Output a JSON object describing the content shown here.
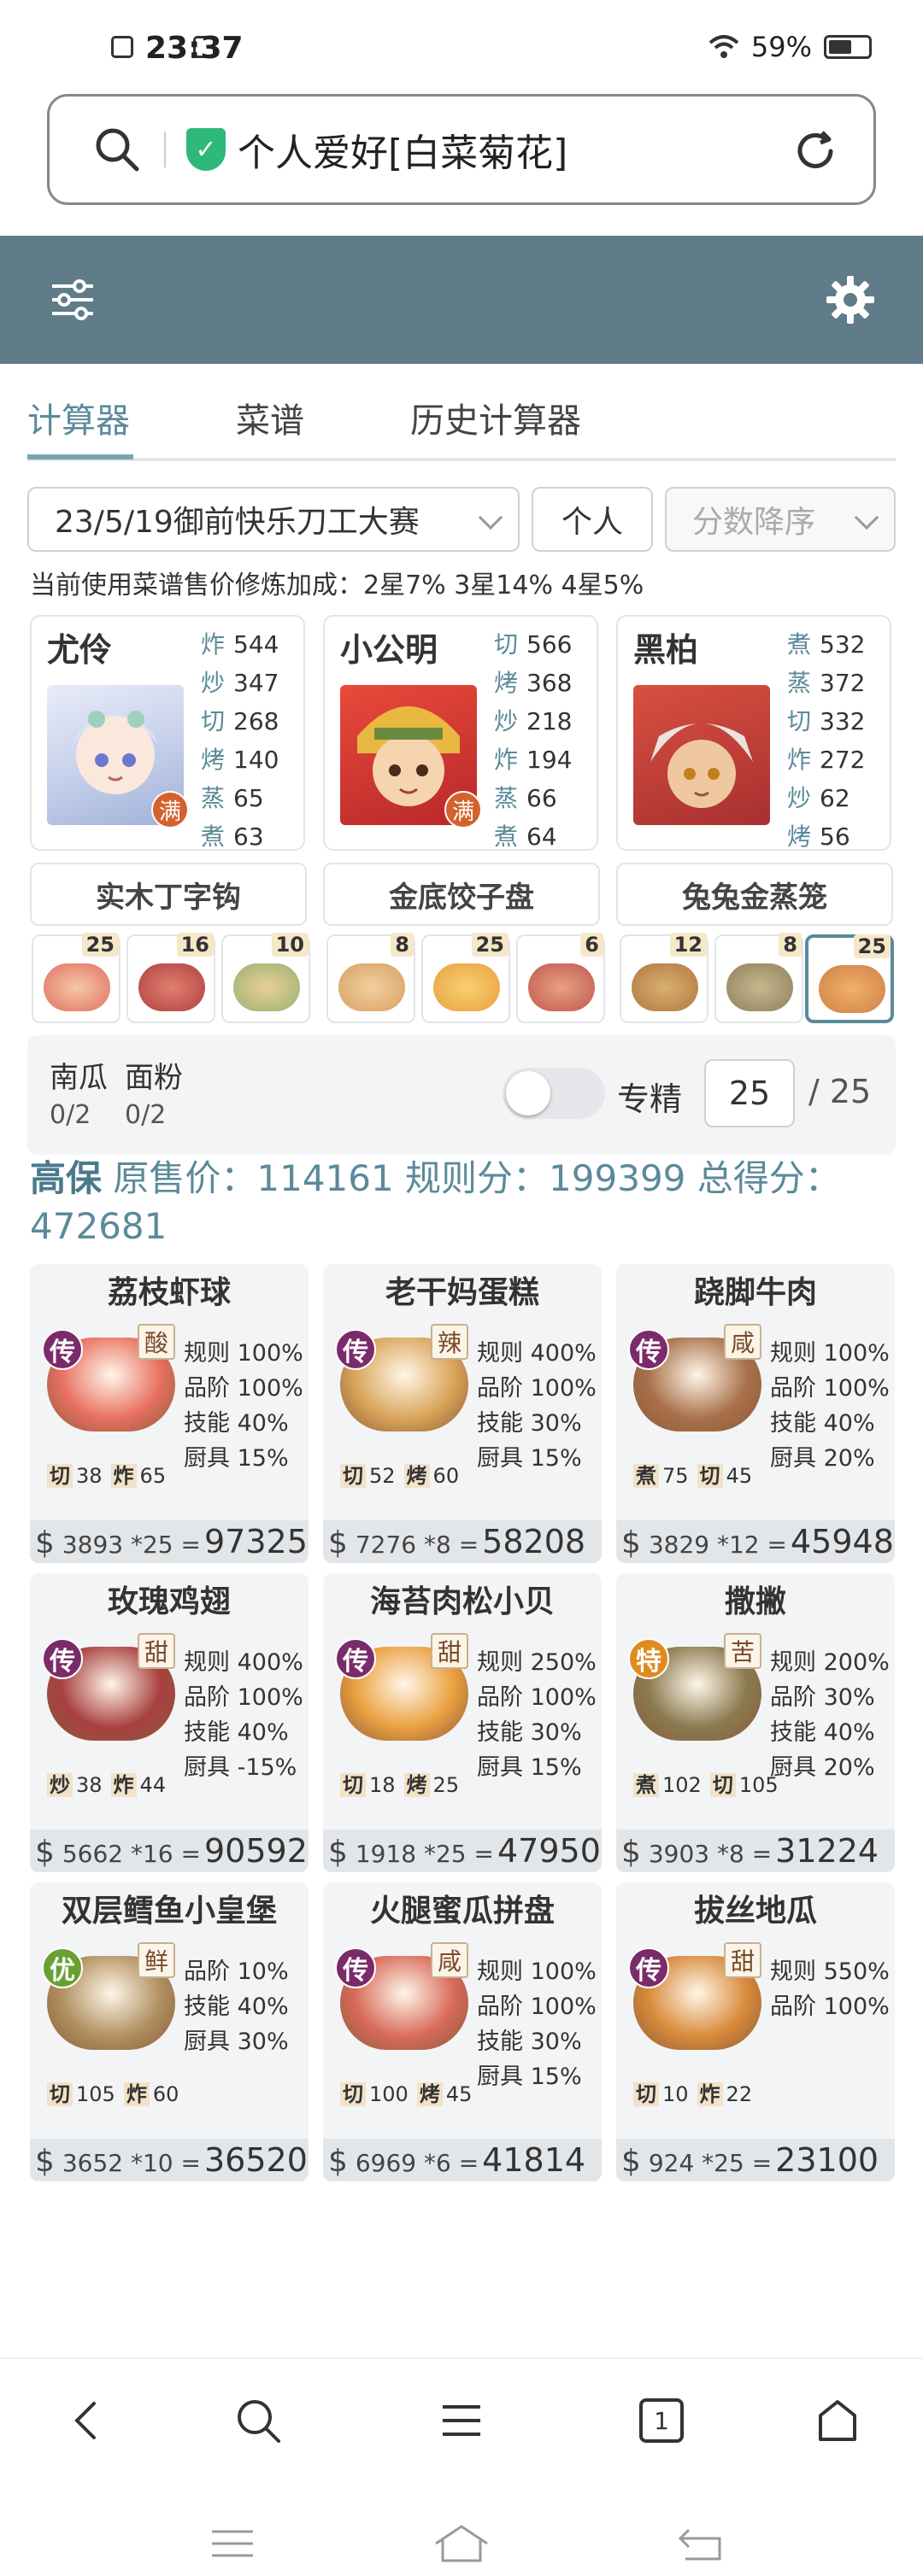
{
  "status": {
    "time": "23:37",
    "battery": "59%"
  },
  "address": {
    "url": "个人爱好[白菜菊花]",
    "secure_mark": "✓"
  },
  "tabs": [
    {
      "label": "计算器"
    },
    {
      "label": "菜谱"
    },
    {
      "label": "历史计算器"
    }
  ],
  "filters": {
    "contest": "23/5/19御前快乐刀工大赛",
    "mode": "个人",
    "sort": "分数降序"
  },
  "bonus_info": "当前使用菜谱售价修炼加成：2星7% 3星14% 4星5%",
  "chefs": [
    {
      "name": "尤伶",
      "badge": "满",
      "stats": [
        {
          "k": "炸",
          "v": "544"
        },
        {
          "k": "炒",
          "v": "347"
        },
        {
          "k": "切",
          "v": "268"
        },
        {
          "k": "烤",
          "v": "140"
        },
        {
          "k": "蒸",
          "v": "65"
        },
        {
          "k": "煮",
          "v": "63"
        }
      ]
    },
    {
      "name": "小公明",
      "badge": "满",
      "stats": [
        {
          "k": "切",
          "v": "566"
        },
        {
          "k": "烤",
          "v": "368"
        },
        {
          "k": "炒",
          "v": "218"
        },
        {
          "k": "炸",
          "v": "194"
        },
        {
          "k": "蒸",
          "v": "66"
        },
        {
          "k": "煮",
          "v": "64"
        }
      ]
    },
    {
      "name": "黑柏",
      "badge": "",
      "stats": [
        {
          "k": "煮",
          "v": "532"
        },
        {
          "k": "蒸",
          "v": "372"
        },
        {
          "k": "切",
          "v": "332"
        },
        {
          "k": "炸",
          "v": "272"
        },
        {
          "k": "炒",
          "v": "62"
        },
        {
          "k": "烤",
          "v": "56"
        }
      ]
    }
  ],
  "equipment": [
    "实木丁字钩",
    "金底饺子盘",
    "兔兔金蒸笼"
  ],
  "slots": [
    {
      "count": "25",
      "color": "#e07060"
    },
    {
      "count": "16",
      "color": "#b04040"
    },
    {
      "count": "10",
      "color": "#9bb070"
    },
    {
      "count": "8",
      "color": "#d8a060"
    },
    {
      "count": "25",
      "color": "#e8a040"
    },
    {
      "count": "6",
      "color": "#c05850"
    },
    {
      "count": "12",
      "color": "#b07840"
    },
    {
      "count": "8",
      "color": "#90805a"
    },
    {
      "count": "25",
      "color": "#d08040"
    }
  ],
  "ingredients": [
    {
      "name": "南瓜",
      "value": "0/2"
    },
    {
      "name": "面粉",
      "value": "0/2"
    }
  ],
  "specialize": {
    "label": "专精",
    "value": "25",
    "total": "/ 25"
  },
  "score": {
    "grade": "高保",
    "text": "原售价：114161 规则分：199399 总得分：472681"
  },
  "dishes": [
    {
      "title": "荔枝虾球",
      "rarity": "传",
      "rarity_color": "#7a2b6a",
      "flavor": "酸",
      "img": "#e87060",
      "props": [
        "规则 100%",
        "品阶 100%",
        "技能 40%",
        "厨具 15%"
      ],
      "skills": [
        {
          "k": "切",
          "v": "38"
        },
        {
          "k": "炸",
          "v": "65"
        }
      ],
      "price": "3893 *25",
      "total": "97325"
    },
    {
      "title": "老干妈蛋糕",
      "rarity": "传",
      "rarity_color": "#7a2b6a",
      "flavor": "辣",
      "img": "#d9a55a",
      "props": [
        "规则 400%",
        "品阶 100%",
        "技能 30%",
        "厨具 15%"
      ],
      "skills": [
        {
          "k": "切",
          "v": "52"
        },
        {
          "k": "烤",
          "v": "60"
        }
      ],
      "price": "7276 *8",
      "total": "58208"
    },
    {
      "title": "跷脚牛肉",
      "rarity": "传",
      "rarity_color": "#7a2b6a",
      "flavor": "咸",
      "img": "#a8704a",
      "props": [
        "规则 100%",
        "品阶 100%",
        "技能 40%",
        "厨具 20%"
      ],
      "skills": [
        {
          "k": "煮",
          "v": "75"
        },
        {
          "k": "切",
          "v": "45"
        }
      ],
      "price": "3829 *12",
      "total": "45948"
    },
    {
      "title": "玫瑰鸡翅",
      "rarity": "传",
      "rarity_color": "#7a2b6a",
      "flavor": "甜",
      "img": "#a84040",
      "props": [
        "规则 400%",
        "品阶 100%",
        "技能 40%",
        "厨具 -15%"
      ],
      "skills": [
        {
          "k": "炒",
          "v": "38"
        },
        {
          "k": "炸",
          "v": "44"
        }
      ],
      "price": "5662 *16",
      "total": "90592"
    },
    {
      "title": "海苔肉松小贝",
      "rarity": "传",
      "rarity_color": "#7a2b6a",
      "flavor": "甜",
      "img": "#eaa040",
      "props": [
        "规则 250%",
        "品阶 100%",
        "技能 30%",
        "厨具 15%"
      ],
      "skills": [
        {
          "k": "切",
          "v": "18"
        },
        {
          "k": "烤",
          "v": "25"
        }
      ],
      "price": "1918 *25",
      "total": "47950"
    },
    {
      "title": "撒撇",
      "rarity": "特",
      "rarity_color": "#e08a20",
      "flavor": "苦",
      "img": "#8a7a50",
      "props": [
        "规则 200%",
        "品阶 30%",
        "技能 40%",
        "厨具 20%"
      ],
      "skills": [
        {
          "k": "煮",
          "v": "102"
        },
        {
          "k": "切",
          "v": "105"
        }
      ],
      "price": "3903 *8",
      "total": "31224"
    },
    {
      "title": "双层鳕鱼小皇堡",
      "rarity": "优",
      "rarity_color": "#6aa032",
      "flavor": "鲜",
      "img": "#b09060",
      "props": [
        "品阶 10%",
        "技能 40%",
        "厨具 30%"
      ],
      "skills": [
        {
          "k": "切",
          "v": "105"
        },
        {
          "k": "炸",
          "v": "60"
        }
      ],
      "price": "3652 *10",
      "total": "36520"
    },
    {
      "title": "火腿蜜瓜拼盘",
      "rarity": "传",
      "rarity_color": "#7a2b6a",
      "flavor": "咸",
      "img": "#d86a5a",
      "props": [
        "规则 100%",
        "品阶 100%",
        "技能 30%",
        "厨具 15%"
      ],
      "skills": [
        {
          "k": "切",
          "v": "100"
        },
        {
          "k": "烤",
          "v": "45"
        }
      ],
      "price": "6969 *6",
      "total": "41814"
    },
    {
      "title": "拔丝地瓜",
      "rarity": "传",
      "rarity_color": "#7a2b6a",
      "flavor": "甜",
      "img": "#d88a3a",
      "props": [
        "规则 550%",
        "品阶 100%"
      ],
      "skills": [
        {
          "k": "切",
          "v": "10"
        },
        {
          "k": "炸",
          "v": "22"
        }
      ],
      "price": "924 *25",
      "total": "23100"
    }
  ],
  "nav": {
    "tab_count": "1"
  },
  "icons": [
    "search-icon",
    "refresh-icon",
    "filter-icon",
    "gear-icon",
    "back-icon",
    "menu-icon",
    "tabs-icon",
    "home-icon"
  ]
}
